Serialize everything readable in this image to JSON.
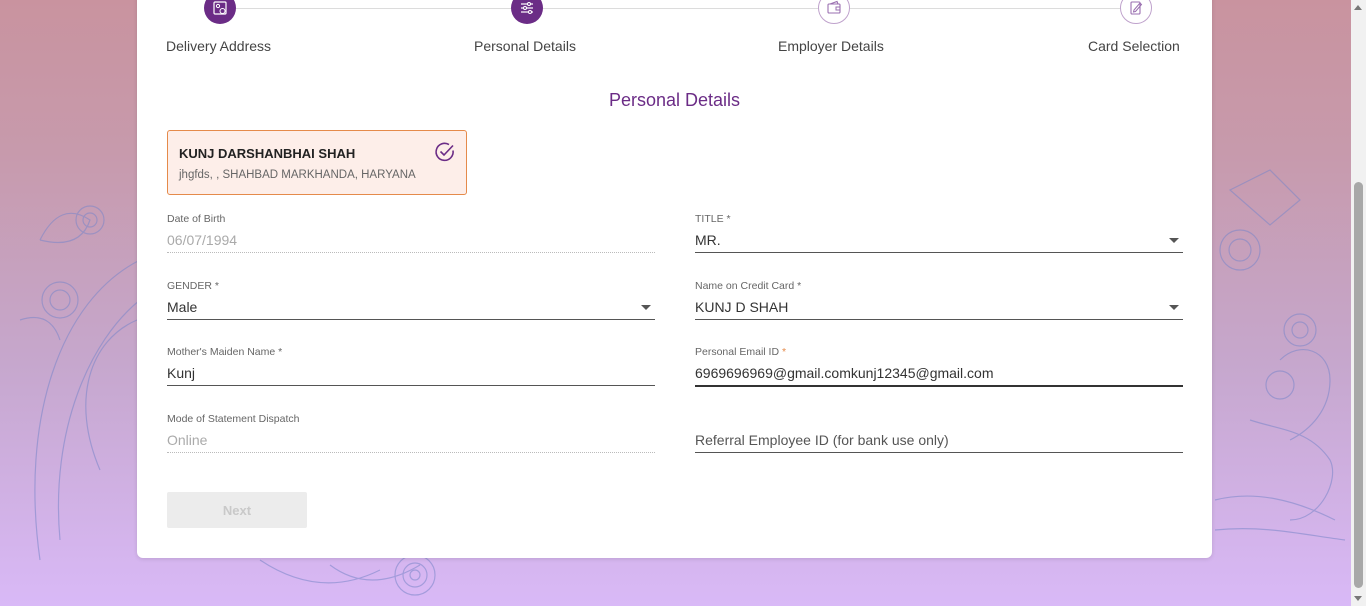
{
  "stepper": {
    "steps": [
      {
        "label": "Delivery Address",
        "icon": "address-card-icon",
        "state": "completed"
      },
      {
        "label": "Personal Details",
        "icon": "sliders-icon",
        "state": "active"
      },
      {
        "label": "Employer Details",
        "icon": "wallet-icon",
        "state": "pending"
      },
      {
        "label": "Card Selection",
        "icon": "edit-document-icon",
        "state": "pending"
      }
    ]
  },
  "section": {
    "title": "Personal Details"
  },
  "address_card": {
    "name": "KUNJ DARSHANBHAI SHAH",
    "address": "jhgfds, , SHAHBAD MARKHANDA, HARYANA"
  },
  "fields": {
    "dob": {
      "label": "Date of Birth",
      "value": "06/07/1994"
    },
    "title": {
      "label": "TITLE *",
      "value": "MR."
    },
    "gender": {
      "label": "GENDER *",
      "value": "Male"
    },
    "name_on_card": {
      "label": "Name on Credit Card *",
      "value": "KUNJ D SHAH"
    },
    "maiden_name": {
      "label": "Mother's Maiden Name *",
      "value": "Kunj"
    },
    "email": {
      "label": "Personal Email ID",
      "required_mark": " *",
      "value": "6969696969@gmail.comkunj12345@gmail.com"
    },
    "statement_mode": {
      "label": "Mode of Statement Dispatch",
      "value": "Online"
    },
    "referral": {
      "placeholder": "Referral Employee ID (for bank use only)"
    }
  },
  "actions": {
    "next_label": "Next"
  },
  "colors": {
    "primary": "#6b2c86",
    "accent": "#e58a4a",
    "selected_bg": "#fdeee9"
  }
}
